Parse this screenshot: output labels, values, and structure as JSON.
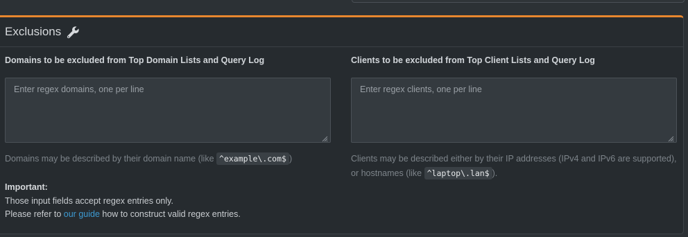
{
  "card": {
    "title": "Exclusions",
    "title_icon": "wrench-icon",
    "accent_color": "#e8872e"
  },
  "domains": {
    "label": "Domains to be excluded from Top Domain Lists and Query Log",
    "placeholder": "Enter regex domains, one per line",
    "value": "",
    "help_prefix": "Domains may be described by their domain name (like",
    "help_code": "^example\\.com$",
    "help_suffix": ")"
  },
  "clients": {
    "label": "Clients to be excluded from Top Client Lists and Query Log",
    "placeholder": "Enter regex clients, one per line",
    "value": "",
    "help_prefix": "Clients may be described either by their IP addresses (IPv4 and IPv6 are supported), or hostnames (like",
    "help_code": "^laptop\\.lan$",
    "help_suffix": ")."
  },
  "notice": {
    "heading": "Important:",
    "line1": "Those input fields accept regex entries only.",
    "line2_prefix": "Please refer to",
    "link_text": "our guide",
    "line2_suffix": "how to construct valid regex entries."
  }
}
